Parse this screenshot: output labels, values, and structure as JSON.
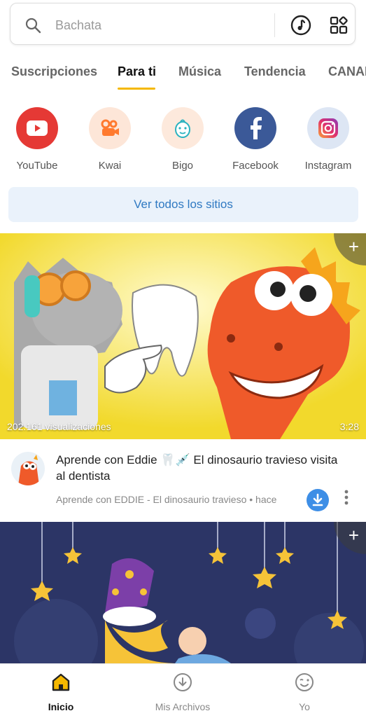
{
  "search": {
    "placeholder": "Bachata"
  },
  "tabs": [
    "Suscripciones",
    "Para ti",
    "Música",
    "Tendencia",
    "CANAL"
  ],
  "sites": [
    {
      "label": "YouTube",
      "icon": "youtube-icon",
      "color": "#e53935"
    },
    {
      "label": "Kwai",
      "icon": "kwai-icon",
      "color": "#ff8a3d"
    },
    {
      "label": "Bigo",
      "icon": "bigo-icon",
      "color": "#2bb3c0"
    },
    {
      "label": "Facebook",
      "icon": "facebook-icon",
      "color": "#3b5998"
    },
    {
      "label": "Instagram",
      "icon": "instagram-icon",
      "color": "#d6249f"
    }
  ],
  "see_all": "Ver todos los sitios",
  "video1": {
    "views": "202.161 visualizaciones",
    "duration": "3:28",
    "title": "Aprende con Eddie 🦷💉 El dinosaurio travieso visita al dentista",
    "channel": "Aprende con EDDIE - El dinosaurio travieso • hace"
  },
  "bottom_nav": {
    "home": "Inicio",
    "files": "Mis Archivos",
    "me": "Yo"
  },
  "colors": {
    "accent": "#f5b800",
    "link": "#2f79c2",
    "download": "#3d8ee6"
  }
}
